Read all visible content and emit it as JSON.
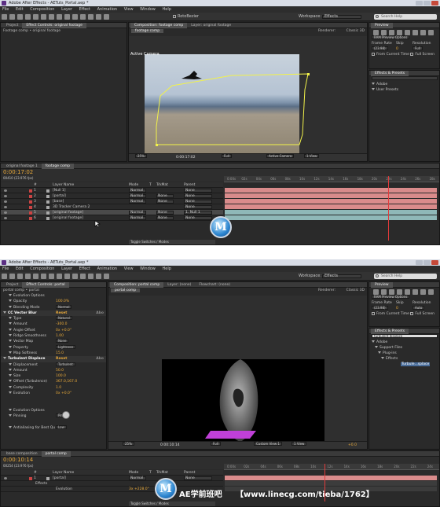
{
  "shot1": {
    "title": "Adobe After Effects - AETuts_Portal.aep *",
    "menu": [
      "File",
      "Edit",
      "Composition",
      "Layer",
      "Effect",
      "Animation",
      "View",
      "Window",
      "Help"
    ],
    "toolbar": {
      "rotobezier": "RotoBezier",
      "workspace_label": "Workspace:",
      "workspace_value": "Effects",
      "search_placeholder": "Search Help"
    },
    "project_tabs": [
      "Project",
      "Effect Controls: original footage"
    ],
    "project_sub": "Footage comp • original footage",
    "comp_tabs": [
      "Composition: footage comp",
      "Layer: original footage"
    ],
    "comp_subtab": "footage comp",
    "renderer_label": "Renderer:",
    "renderer_value": "Classic 3D",
    "viewer_label": "Active Camera",
    "viewer_zoom": "25%",
    "viewer_timecode": "0:00:17:02",
    "viewer_res": "Full",
    "viewer_view": "Active Camera",
    "viewer_views": "1 View",
    "preview": {
      "title": "Preview",
      "ram": "RAM Preview Options",
      "frame_rate": "Frame Rate",
      "skip": "Skip",
      "resolution": "Resolution",
      "fps": "(23.98)",
      "skip_val": "0",
      "res_val": "Full",
      "from_current": "From Current Time",
      "full_screen": "Full Screen"
    },
    "effects": {
      "title": "Effects & Presets",
      "items": [
        "Adobe",
        "User Presets"
      ]
    },
    "tl_tabs": [
      "original footage 1",
      "footage comp"
    ],
    "tl_time": "0:00:17:02",
    "tl_fps": "00410 (23.976 fps)",
    "tl_cols": {
      "layer_name": "Layer Name",
      "mode": "Mode",
      "t": "T",
      "trkmat": "TrkMat",
      "parent": "Parent"
    },
    "layers": [
      {
        "num": "1",
        "name": "[Null 1]",
        "mode": "Normal",
        "trk": "",
        "parent": "None",
        "color": "#c44"
      },
      {
        "num": "2",
        "name": "[portal]",
        "mode": "Normal",
        "trk": "None",
        "parent": "None",
        "color": "#c44"
      },
      {
        "num": "3",
        "name": "[base]",
        "mode": "Normal",
        "trk": "None",
        "parent": "None",
        "color": "#c44"
      },
      {
        "num": "4",
        "name": "3D Tracker Camera 2",
        "mode": "",
        "trk": "",
        "parent": "None",
        "color": "#c44"
      },
      {
        "num": "5",
        "name": "[original footage]",
        "mode": "Normal",
        "trk": "None",
        "parent": "1. Null 1",
        "color": "#c44"
      },
      {
        "num": "6",
        "name": "[original footage]",
        "mode": "Normal",
        "trk": "None",
        "parent": "None",
        "color": "#c44"
      }
    ],
    "ruler": [
      "0:00s",
      "02s",
      "04s",
      "06s",
      "08s",
      "10s",
      "12s",
      "14s",
      "16s",
      "18s",
      "20s",
      "22s",
      "24s",
      "26s",
      "28s"
    ],
    "toggle": "Toggle Switches / Modes",
    "accent": "#e8a93a",
    "track_color": "#d98b8b"
  },
  "shot2": {
    "title": "Adobe After Effects - AETuts_Portal.aep *",
    "menu": [
      "File",
      "Edit",
      "Composition",
      "Layer",
      "Effect",
      "Animation",
      "View",
      "Window",
      "Help"
    ],
    "toolbar": {
      "workspace_label": "Workspace:",
      "workspace_value": "Effects",
      "search_placeholder": "Search Help"
    },
    "project_tabs": [
      "Project",
      "Effect Controls: portal"
    ],
    "project_sub": "portal comp • portal",
    "fx_rows": [
      {
        "label": "Evolution Options",
        "value": "",
        "hdr": false,
        "indent": 1
      },
      {
        "label": "Opacity",
        "value": "100.0%",
        "hdr": false,
        "indent": 1
      },
      {
        "label": "Blending Mode",
        "value": "Normal",
        "hdr": false,
        "indent": 1,
        "dd": true
      },
      {
        "label": "CC Vector Blur",
        "value": "Reset",
        "hdr": true,
        "indent": 0,
        "about": "Abo"
      },
      {
        "label": "Type",
        "value": "Natural",
        "hdr": false,
        "indent": 1,
        "dd": true
      },
      {
        "label": "Amount",
        "value": "-300.0",
        "hdr": false,
        "indent": 1
      },
      {
        "label": "Angle Offset",
        "value": "0x +0.0°",
        "hdr": false,
        "indent": 1
      },
      {
        "label": "Ridge Smoothness",
        "value": "1.00",
        "hdr": false,
        "indent": 1
      },
      {
        "label": "Vector Map",
        "value": "None",
        "hdr": false,
        "indent": 1,
        "dd": true
      },
      {
        "label": "Property",
        "value": "Lightness",
        "hdr": false,
        "indent": 1,
        "dd": true
      },
      {
        "label": "Map Softness",
        "value": "15.0",
        "hdr": false,
        "indent": 1
      },
      {
        "label": "Turbulent Displace",
        "value": "Reset",
        "hdr": true,
        "indent": 0,
        "about": "Abo"
      },
      {
        "label": "Displacement",
        "value": "Turbulent",
        "hdr": false,
        "indent": 1,
        "dd": true
      },
      {
        "label": "Amount",
        "value": "50.0",
        "hdr": false,
        "indent": 1
      },
      {
        "label": "Size",
        "value": "100.0",
        "hdr": false,
        "indent": 1
      },
      {
        "label": "Offset (Turbulence)",
        "value": "367.0,167.0",
        "hdr": false,
        "indent": 1
      },
      {
        "label": "Complexity",
        "value": "1.0",
        "hdr": false,
        "indent": 1
      },
      {
        "label": "Evolution",
        "value": "0x +0.0°",
        "hdr": false,
        "indent": 1
      },
      {
        "label": "",
        "value": "",
        "hdr": false,
        "indent": 1
      },
      {
        "label": "",
        "value": "",
        "hdr": false,
        "indent": 1
      },
      {
        "label": "Evolution Options",
        "value": "",
        "hdr": false,
        "indent": 1
      },
      {
        "label": "Pinning",
        "value": "Pin All",
        "hdr": false,
        "indent": 1,
        "dd": true
      },
      {
        "label": "",
        "value": "",
        "hdr": false,
        "indent": 1
      },
      {
        "label": "Antialiasing for Best Qu",
        "value": "Low",
        "hdr": false,
        "indent": 1,
        "dd": true
      }
    ],
    "comp_tabs": [
      "Composition: portal comp",
      "Layer: (none)",
      "Flowchart: (none)"
    ],
    "comp_subtab": "portal comp",
    "renderer_label": "Renderer:",
    "renderer_value": "Classic 3D",
    "viewer_zoom": "25%",
    "viewer_timecode": "0:00:10:14",
    "viewer_res": "Full",
    "viewer_view": "Custom View 1",
    "viewer_views": "1 View",
    "viewer_exposure": "+0.0",
    "preview": {
      "title": "Preview",
      "ram": "RAM Preview Options",
      "frame_rate": "Frame Rate",
      "skip": "Skip",
      "resolution": "Resolution",
      "fps": "(23.98)",
      "skip_val": "0",
      "res_val": "Auto",
      "from_current": "From Current Time",
      "full_screen": "Full Screen"
    },
    "effects": {
      "title": "Effects & Presets",
      "search_value": "turbulent displace",
      "items": [
        "Adobe",
        "Support Files",
        "Plug-ins",
        "Effects",
        "Turbule...splace"
      ]
    },
    "tl_tabs": [
      "base composition",
      "portal comp"
    ],
    "tl_time": "0:00:10:14",
    "tl_fps": "00254 (23.976 fps)",
    "tl_cols": {
      "layer_name": "Layer Name",
      "mode": "Mode",
      "t": "T",
      "trkmat": "TrkMat",
      "parent": "Parent"
    },
    "layer": {
      "num": "1",
      "name": "[portal]",
      "mode": "Normal",
      "parent": "None"
    },
    "sub_rows": [
      {
        "label": "Effects",
        "value": ""
      },
      {
        "label": "Evolution",
        "value": "3x +228.0°"
      }
    ],
    "ruler": [
      "0:00s",
      "02s",
      "04s",
      "06s",
      "08s",
      "10s",
      "12s",
      "14s",
      "16s",
      "18s",
      "20s",
      "22s",
      "24s"
    ],
    "toggle": "Toggle Switches / Modes"
  },
  "watermark": {
    "left": "AE学前班吧",
    "right": "【www.linecg.com/tieba/1762】"
  },
  "logo_letter": "M"
}
